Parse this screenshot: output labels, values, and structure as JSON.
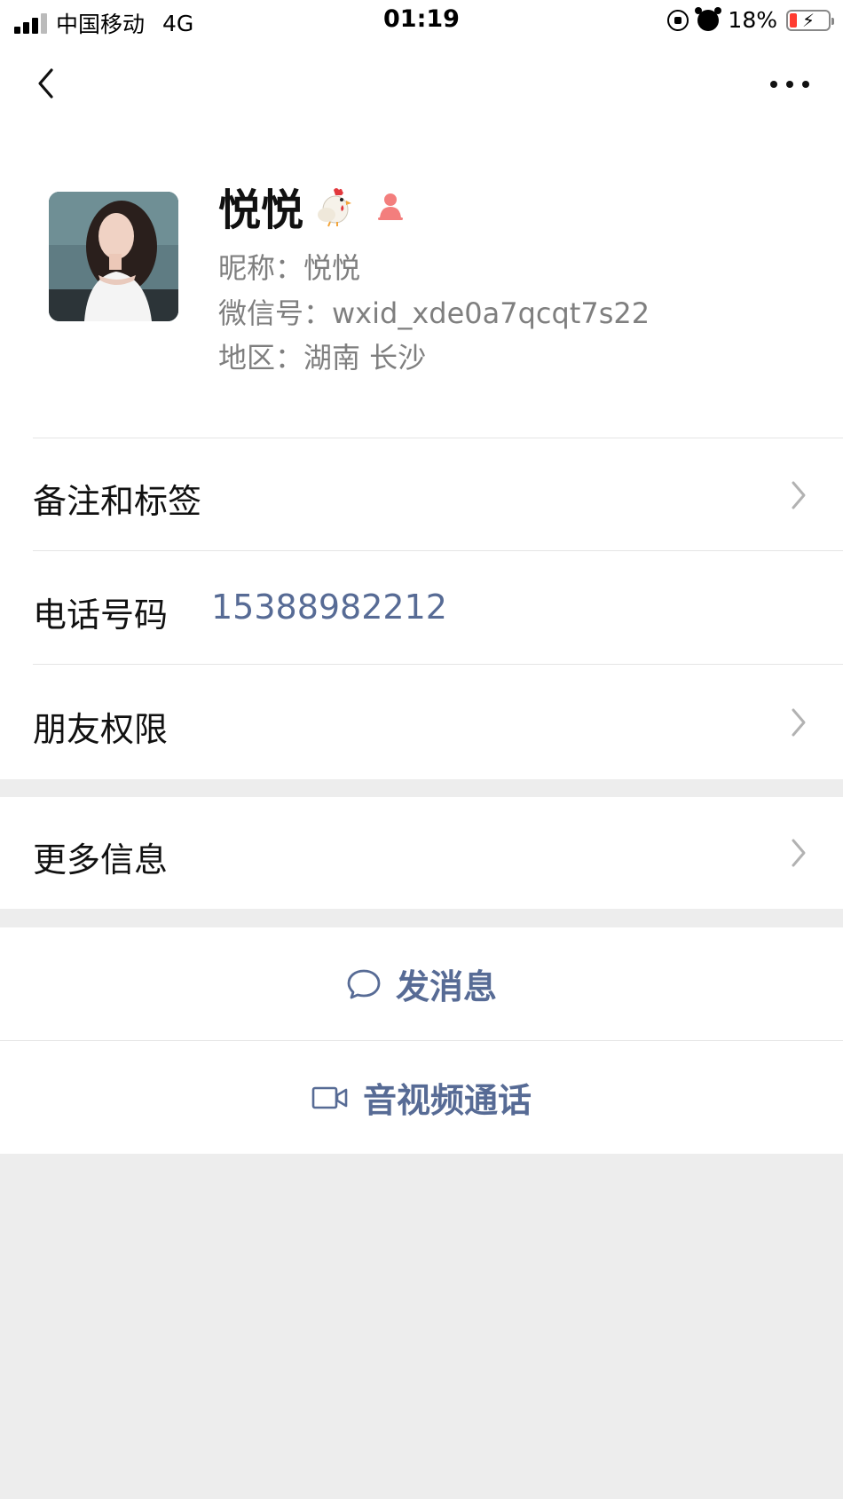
{
  "status_bar": {
    "carrier": "中国移动",
    "network": "4G",
    "time": "01:19",
    "battery": "18%",
    "battery_level": 0.18
  },
  "profile": {
    "name": "悦悦",
    "nickname_line": "昵称：悦悦",
    "wechat_id_line": "微信号：wxid_xde0a7qcqt7s22",
    "region_line": "地区：湖南 长沙",
    "gender_color": "#f37e7d"
  },
  "cells": {
    "remarks_label": "备注和标签",
    "phone_label": "电话号码",
    "phone_value": "15388982212",
    "permissions_label": "朋友权限",
    "more_info_label": "更多信息"
  },
  "actions": {
    "message_label": "发消息",
    "call_label": "音视频通话",
    "accent_color": "#576b95"
  }
}
